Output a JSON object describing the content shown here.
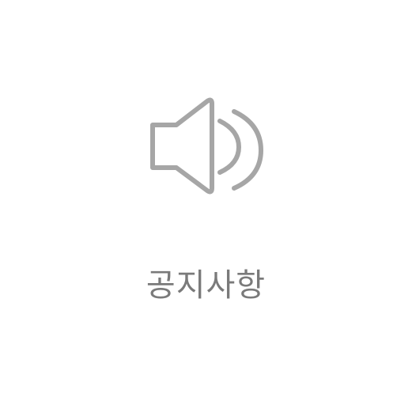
{
  "tile": {
    "icon": "speaker-volume-icon",
    "label": "공지사항"
  },
  "colors": {
    "icon": "#a6a6a6",
    "label": "#7a7a7a",
    "background": "#ffffff"
  }
}
